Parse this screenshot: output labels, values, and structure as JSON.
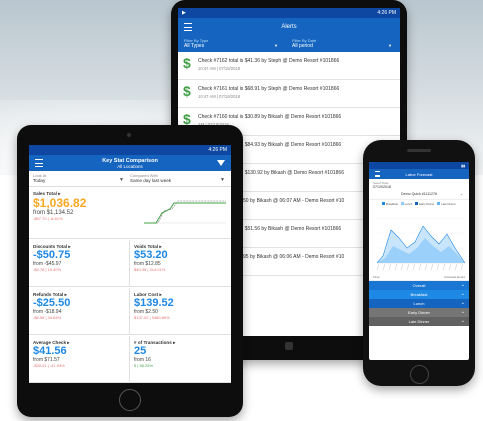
{
  "alerts_tablet": {
    "title": "Alerts",
    "status_time": "4:26 PM",
    "filter_type_label": "Filter By Type",
    "filter_type_value": "All Types",
    "filter_date_label": "Filter By Date",
    "filter_date_value": "All period",
    "items": [
      {
        "title": "Check #7162 total is $41.36 by Steph @ Demo Resort #101866",
        "time": "10:47 AM | 07/19/2018"
      },
      {
        "title": "Check #7161 total is $68.91 by Steph @ Demo Resort #101866",
        "time": "10:47 AM | 07/19/2018"
      },
      {
        "title": "Check #7160 total is $30.89 by Bikash @ Demo Resort #101866",
        "time": "AM | 07/19/2018"
      },
      {
        "title": "Check #7159 total is $84.93 by Bikash @ Demo Resort #101866",
        "time": "AM | 07/19/2018"
      },
      {
        "title": "Check #7158 total is $130.92 by Bikash @ Demo Resort #101866",
        "time": "AM | 07/19/2018"
      },
      {
        "title": "Check #8157 for $7.50 by Bikash @ 06:07 AM - Demo Resort #10",
        "time": ""
      },
      {
        "title": "Check #7157 total is $51.56 by Bikash @ Demo Resort #101866",
        "time": "AM | 07/19/2018"
      },
      {
        "title": "Check #8156 for $9.95 by Bikash @ 06:06 AM - Demo Resort #10",
        "time": ""
      }
    ]
  },
  "keystats_tablet": {
    "title": "Key Stat Comparison",
    "subtitle": "All Locations",
    "status_time": "4:26 PM",
    "look_at_label": "Look At",
    "look_at_value": "Today",
    "compared_label": "Compared With",
    "compared_value": "Same day last week",
    "sales": {
      "label": "Sales Total",
      "value": "$1,036.82",
      "from": "from $1,134.52",
      "change": "-$97.70 | -8.61%"
    },
    "tiles": [
      {
        "label": "Discounts Total",
        "value": "-$50.75",
        "from": "from -$45.97",
        "change": "-$4.78 | 10.40%"
      },
      {
        "label": "Voids Total",
        "value": "$53.20",
        "from": "from $12.85",
        "change": "$40.35 | 314.01%"
      },
      {
        "label": "Refunds Total",
        "value": "-$25.50",
        "from": "from -$18.94",
        "change": "-$6.56 | 34.64%"
      },
      {
        "label": "Labor Cost",
        "value": "$139.52",
        "from": "from $2.50",
        "change": "$137.02 | 5480.80%"
      },
      {
        "label": "Average Check",
        "value": "$41.56",
        "from": "from $71.57",
        "change": "-$30.01 | -41.93%"
      },
      {
        "label": "# of Transactions",
        "value": "25",
        "from": "from 16",
        "change": "9 | 56.25%"
      }
    ]
  },
  "phone": {
    "title": "Labor Forecast",
    "date_label": "Select Date",
    "date_value": "07/19/2018",
    "location": "Demo Quick #1111276",
    "legend": [
      "Breakfast",
      "Lunch",
      "Early Dinner",
      "Late Dinner"
    ],
    "time_label": "Time",
    "forecast_label": "Forecast Hours",
    "rows": [
      {
        "label": "Overall",
        "color": "#1976d2"
      },
      {
        "label": "Breakfast",
        "color": "#1e88e5"
      },
      {
        "label": "Lunch",
        "color": "#1565c0"
      },
      {
        "label": "Early Dinner",
        "color": "#757575"
      },
      {
        "label": "Late Dinner",
        "color": "#616161"
      }
    ]
  }
}
